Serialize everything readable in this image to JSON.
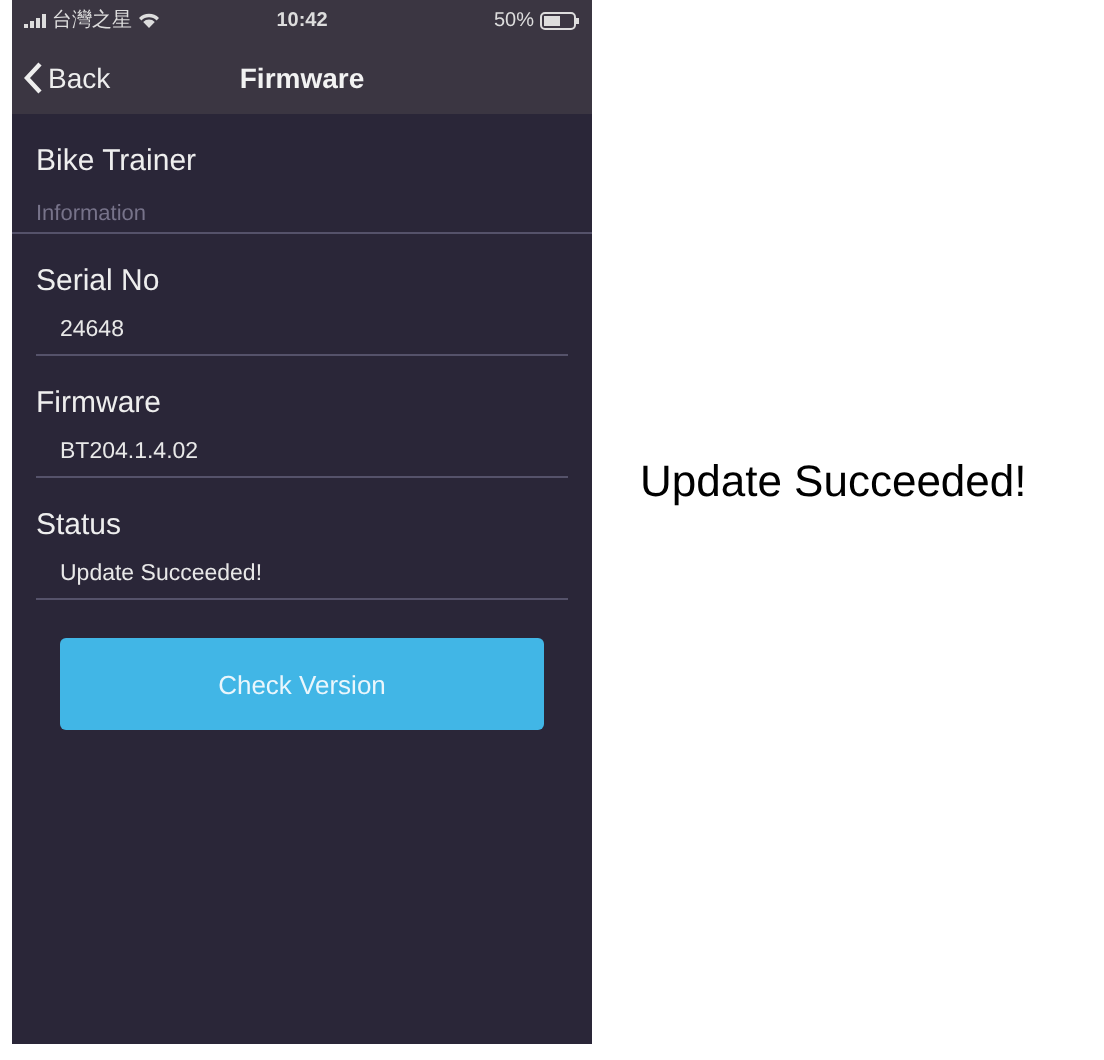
{
  "status_bar": {
    "carrier": "台灣之星",
    "time": "10:42",
    "battery": "50%"
  },
  "nav": {
    "back": "Back",
    "title": "Firmware"
  },
  "device": "Bike Trainer",
  "section": "Information",
  "fields": [
    {
      "label": "Serial No",
      "value": "24648"
    },
    {
      "label": "Firmware",
      "value": "BT204.1.4.02"
    },
    {
      "label": "Status",
      "value": "Update Succeeded!"
    }
  ],
  "button": "Check Version",
  "caption": "Update Succeeded!"
}
